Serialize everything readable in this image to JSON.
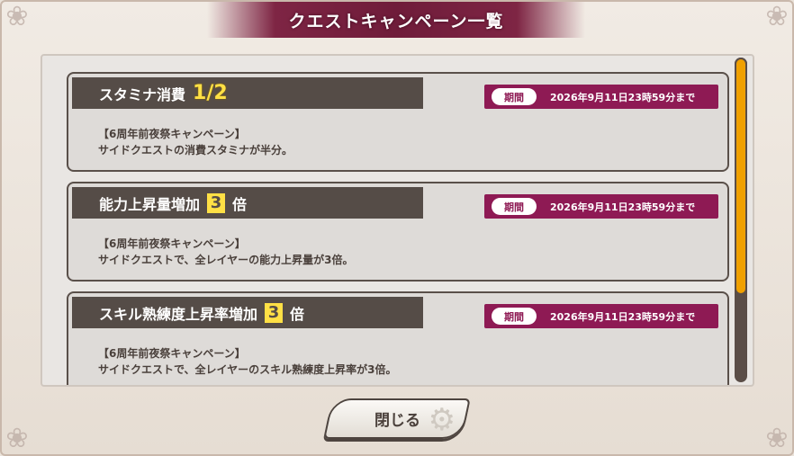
{
  "dialog": {
    "title": "クエストキャンペーン一覧",
    "close_label": "閉じる"
  },
  "campaigns": [
    {
      "name": "スタミナ消費",
      "multiplier": "1/2",
      "multiplier_style": "text",
      "suffix": "",
      "period_label": "期間",
      "period_text": "2026年9月11日23時59分まで",
      "desc_line1": "【6周年前夜祭キャンペーン】",
      "desc_line2": "サイドクエストの消費スタミナが半分。"
    },
    {
      "name": "能力上昇量増加",
      "multiplier": "3",
      "multiplier_style": "box",
      "suffix": "倍",
      "period_label": "期間",
      "period_text": "2026年9月11日23時59分まで",
      "desc_line1": "【6周年前夜祭キャンペーン】",
      "desc_line2": "サイドクエストで、全レイヤーの能力上昇量が3倍。"
    },
    {
      "name": "スキル熟練度上昇率増加",
      "multiplier": "3",
      "multiplier_style": "box",
      "suffix": "倍",
      "period_label": "期間",
      "period_text": "2026年9月11日23時59分まで",
      "desc_line1": "【6周年前夜祭キャンペーン】",
      "desc_line2": "サイドクエストで、全レイヤーのスキル熟練度上昇率が3倍。"
    }
  ],
  "scroll": {
    "position_fraction": 0,
    "visible_fraction": 0.73
  },
  "colors": {
    "title_bg": "#6f1c3a",
    "header_bg": "#554c47",
    "period_bg": "#8e1a54",
    "multiplier": "#ffe045",
    "scroll_thumb": "#f0a000"
  },
  "icons": {
    "corner": "ornament-icon",
    "button_deco": "gear-icon"
  }
}
